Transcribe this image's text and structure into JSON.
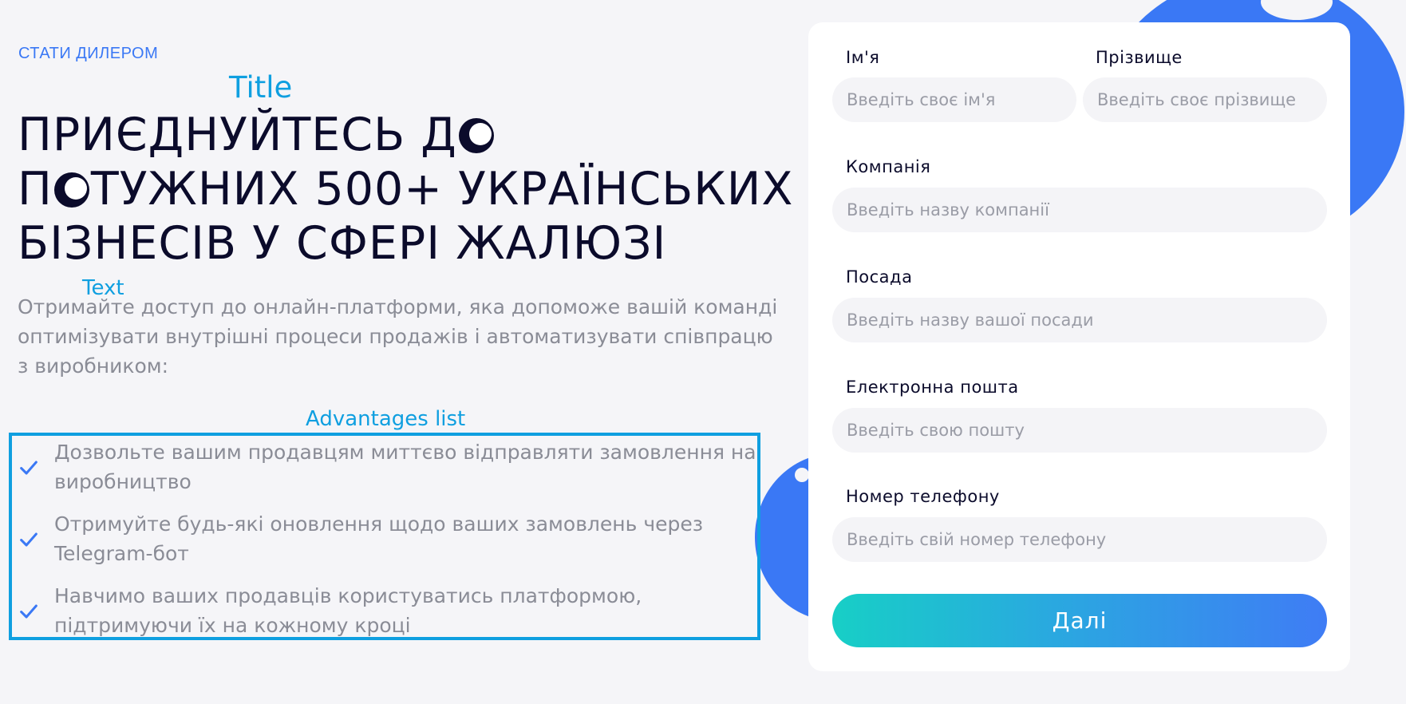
{
  "eyebrow": "СТАТИ ДИЛЕРОМ",
  "annotations": {
    "title": "Title",
    "text": "Text",
    "advantages": "Advantages list"
  },
  "title": {
    "line1_a": "ПРИЄДНУЙТЕСЬ Д",
    "line2_a": "П",
    "line2_b": "ТУЖНИХ 500+ УКРАЇНСЬКИХ",
    "line3": "БІЗНЕСІВ У СФЕРІ ЖАЛЮЗІ"
  },
  "lead": "Отримайте доступ до онлайн-платформи, яка допоможе вашій команді оптимізувати внутрішні процеси продажів і автоматизувати співпрацю з виробником:",
  "advantages": [
    {
      "text": "Дозвольте вашим продавцям миттєво відправляти замовлення на виробництво"
    },
    {
      "text": "Отримуйте будь-які оновлення щодо ваших замовлень через Telegram-бот"
    },
    {
      "text": "Навчимо ваших продавців користуватись платформою, підтримуючи їх на кожному кроці"
    }
  ],
  "form": {
    "first_name": {
      "label": "Ім'я",
      "placeholder": "Введіть своє ім'я",
      "value": ""
    },
    "last_name": {
      "label": "Прізвище",
      "placeholder": "Введіть своє прізвище",
      "value": ""
    },
    "company": {
      "label": "Компанія",
      "placeholder": "Введіть назву компанії",
      "value": ""
    },
    "position": {
      "label": "Посада",
      "placeholder": "Введіть назву вашої посади",
      "value": ""
    },
    "email": {
      "label": "Електронна пошта",
      "placeholder": "Введіть свою пошту",
      "value": ""
    },
    "phone": {
      "label": "Номер телефону",
      "placeholder": "Введіть свій номер телефону",
      "value": ""
    },
    "submit_label": "Далі"
  },
  "colors": {
    "accent": "#3a78f5",
    "annotation": "#0f9fe0",
    "button_gradient_start": "#17cfc6",
    "button_gradient_end": "#3f7cf5"
  },
  "icons": {
    "check": "check-icon"
  }
}
